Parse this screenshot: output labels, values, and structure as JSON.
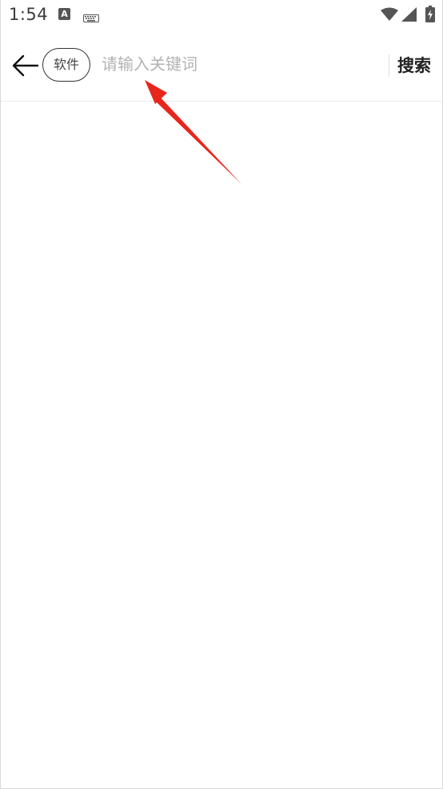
{
  "status_bar": {
    "time": "1:54",
    "notification_letter": "A",
    "icons": [
      "text-notification-icon",
      "keyboard-icon",
      "wifi-icon",
      "signal-icon",
      "battery-charging-icon"
    ]
  },
  "search": {
    "category_label": "软件",
    "placeholder": "请输入关键词",
    "value": "",
    "search_button_label": "搜索",
    "back_icon": "arrow-left-icon"
  },
  "annotation": {
    "type": "red-arrow",
    "points_to": "search-input",
    "color": "#e8261c"
  }
}
